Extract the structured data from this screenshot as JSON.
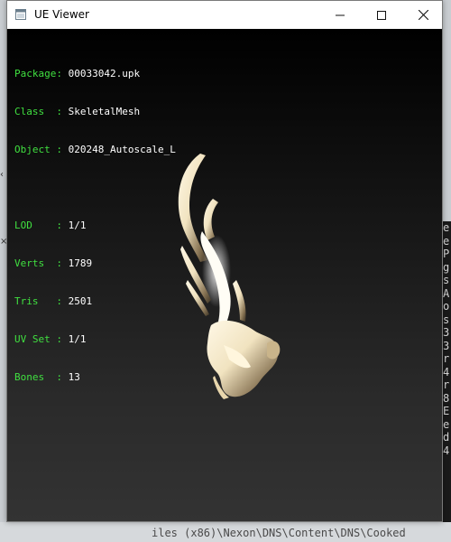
{
  "window": {
    "title": "UE Viewer",
    "min_symbol": "—",
    "max_symbol": "☐",
    "close_symbol": "✕"
  },
  "info": {
    "package": {
      "label": "Package:",
      "value": "00033042.upk"
    },
    "class": {
      "label": "Class  :",
      "value": "SkeletalMesh"
    },
    "object": {
      "label": "Object :",
      "value": "020248_Autoscale_L"
    },
    "lod": {
      "label": "LOD    :",
      "value": "1/1"
    },
    "verts": {
      "label": "Verts  :",
      "value": "1789"
    },
    "tris": {
      "label": "Tris   :",
      "value": "2501"
    },
    "uvset": {
      "label": "UV Set :",
      "value": "1/1"
    },
    "bones": {
      "label": "Bones  :",
      "value": "13"
    }
  },
  "background": {
    "console_lines": [
      "e",
      "e",
      "P",
      "g",
      "s",
      "A",
      "o",
      "s",
      "3",
      "3",
      "r",
      "",
      "4",
      "r",
      "8",
      "E",
      "e",
      "d",
      "4",
      ""
    ],
    "bottom_text": "iles (x86)\\Nexon\\DNS\\Content\\DNS\\Cooked"
  },
  "colors": {
    "label_green": "#40e040",
    "value_white": "#ffffff"
  }
}
